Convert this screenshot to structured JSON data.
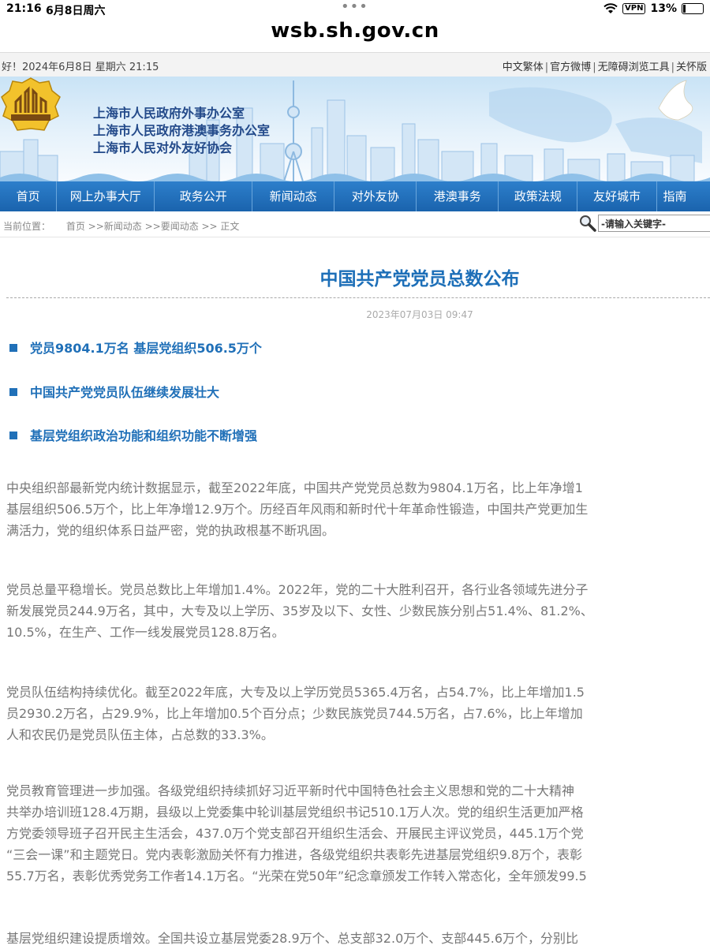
{
  "status_bar": {
    "time": "21:16",
    "date": "6月8日周六",
    "vpn": "VPN",
    "battery": "13%"
  },
  "browser": {
    "url": "wsb.sh.gov.cn"
  },
  "topbar": {
    "greeting": "好！2024年6月8日 星期六 21:15",
    "links": [
      "中文繁体",
      "官方微博",
      "无障碍浏览工具",
      "关怀版"
    ]
  },
  "banner": {
    "org_names": [
      "上海市人民政府外事办公室",
      "上海市人民政府港澳事务办公室",
      "上海市人民对外友好协会"
    ]
  },
  "nav": {
    "items": [
      "首页",
      "网上办事大厅",
      "政务公开",
      "新闻动态",
      "对外友协",
      "港澳事务",
      "政策法规",
      "友好城市",
      "指南"
    ]
  },
  "breadcrumb": {
    "label": "当前位置：",
    "path": "首页 >>新闻动态 >>要闻动态 >> 正文"
  },
  "search": {
    "placeholder": "-请输入关键字-"
  },
  "article": {
    "title": "中国共产党党员总数公布",
    "date": "2023年07月03日 09:47",
    "points": [
      "党员9804.1万名  基层党组织506.5万个",
      "中国共产党党员队伍继续发展壮大",
      "基层党组织政治功能和组织功能不断增强"
    ],
    "paragraphs": [
      [
        "中央组织部最新党内统计数据显示，截至2022年底，中国共产党党员总数为9804.1万名，比上年净增1",
        "基层组织506.5万个，比上年净增12.9万个。历经百年风雨和新时代十年革命性锻造，中国共产党更加生",
        "满活力，党的组织体系日益严密，党的执政根基不断巩固。"
      ],
      [
        "党员总量平稳增长。党员总数比上年增加1.4%。2022年，党的二十大胜利召开，各行业各领域先进分子",
        "新发展党员244.9万名，其中，大专及以上学历、35岁及以下、女性、少数民族分别占51.4%、81.2%、",
        "10.5%，在生产、工作一线发展党员128.8万名。"
      ],
      [
        "党员队伍结构持续优化。截至2022年底，大专及以上学历党员5365.4万名，占54.7%，比上年增加1.5",
        "员2930.2万名，占29.9%，比上年增加0.5个百分点；少数民族党员744.5万名，占7.6%，比上年增加",
        "人和农民仍是党员队伍主体，占总数的33.3%。"
      ],
      [
        "党员教育管理进一步加强。各级党组织持续抓好习近平新时代中国特色社会主义思想和党的二十大精神",
        "共举办培训班128.4万期，县级以上党委集中轮训基层党组织书记510.1万人次。党的组织生活更加严格",
        "方党委领导班子召开民主生活会，437.0万个党支部召开组织生活会、开展民主评议党员，445.1万个党",
        "“三会一课”和主题党日。党内表彰激励关怀有力推进，各级党组织共表彰先进基层党组织9.8万个，表彰",
        "55.7万名，表彰优秀党务工作者14.1万名。“光荣在党50年”纪念章颁发工作转入常态化，全年颁发99.5"
      ],
      [
        "基层党组织建设提质增效。全国共设立基层党委28.9万个、总支部32.0万个、支部445.6万个，分别比"
      ]
    ]
  }
}
